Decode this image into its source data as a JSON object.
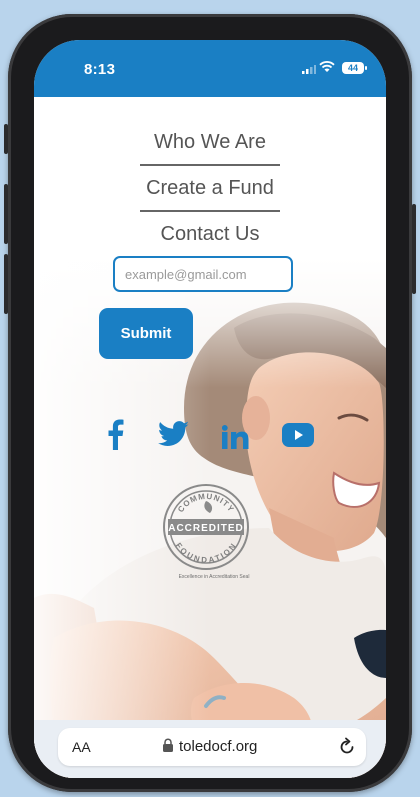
{
  "status_bar": {
    "time": "8:13",
    "battery": "44"
  },
  "nav": {
    "items": [
      {
        "label": "Who We Are"
      },
      {
        "label": "Create a Fund"
      },
      {
        "label": "Contact Us"
      }
    ]
  },
  "subscribe": {
    "email_placeholder": "example@gmail.com",
    "submit_label": "Submit"
  },
  "social": {
    "icons": [
      "facebook-icon",
      "twitter-icon",
      "linkedin-icon",
      "youtube-icon"
    ],
    "color": "#1a7fc4"
  },
  "badge": {
    "top_text": "COMMUNITY",
    "center_text": "ACCREDITED",
    "bottom_text": "FOUNDATION",
    "caption": "Excellence in Accreditation Seal"
  },
  "browser": {
    "text_size_label": "AA",
    "url": "toledocf.org"
  },
  "colors": {
    "brand": "#1a7fc4",
    "nav_text": "#555555"
  }
}
